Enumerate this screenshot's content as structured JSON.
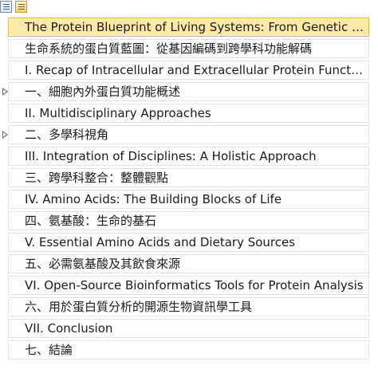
{
  "toolbar": {
    "buttons": [
      {
        "icon": "outline-list-icon"
      },
      {
        "icon": "outline-list-highlight-icon"
      }
    ]
  },
  "outline": {
    "items": [
      {
        "label": "The Protein Blueprint of Living Systems: From Genetic Encoding to Cellular Function",
        "selected": true,
        "expandable": false
      },
      {
        "label": "生命系統的蛋白質藍圖：從基因編碼到跨學科功能解碼",
        "selected": false,
        "expandable": false
      },
      {
        "label": "I. Recap of Intracellular and Extracellular Protein Functions",
        "selected": false,
        "expandable": false
      },
      {
        "label": "一、細胞內外蛋白質功能概述",
        "selected": false,
        "expandable": true
      },
      {
        "label": "II. Multidisciplinary Approaches",
        "selected": false,
        "expandable": false
      },
      {
        "label": "二、多學科視角",
        "selected": false,
        "expandable": true
      },
      {
        "label": "III. Integration of Disciplines: A Holistic Approach",
        "selected": false,
        "expandable": false
      },
      {
        "label": "三、跨學科整合：整體觀點",
        "selected": false,
        "expandable": false
      },
      {
        "label": "IV. Amino Acids: The Building Blocks of Life",
        "selected": false,
        "expandable": false
      },
      {
        "label": "四、氨基酸：生命的基石",
        "selected": false,
        "expandable": false
      },
      {
        "label": "V. Essential Amino Acids and Dietary Sources",
        "selected": false,
        "expandable": false
      },
      {
        "label": "五、必需氨基酸及其飲食來源",
        "selected": false,
        "expandable": false
      },
      {
        "label": "VI. Open-Source Bioinformatics Tools for Protein Analysis",
        "selected": false,
        "expandable": false
      },
      {
        "label": "六、用於蛋白質分析的開源生物資訊學工具",
        "selected": false,
        "expandable": false
      },
      {
        "label": "VII. Conclusion",
        "selected": false,
        "expandable": false
      },
      {
        "label": "七、結論",
        "selected": false,
        "expandable": false
      }
    ]
  },
  "colors": {
    "selected_background": "#fce9a8",
    "selected_border": "#e2b94b",
    "row_border": "#e3e3e3",
    "text": "#1b1b1b"
  }
}
